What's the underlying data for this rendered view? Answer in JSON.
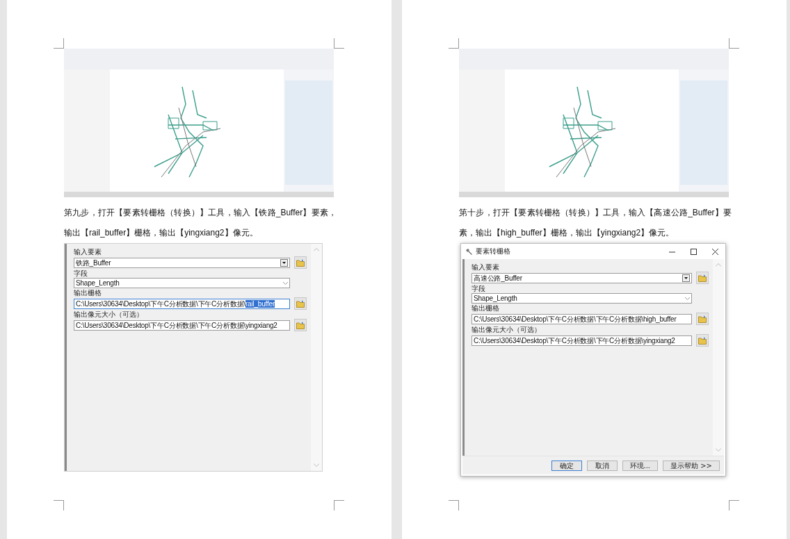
{
  "pages": [
    {
      "paragraph": "第九步，打开【要素转栅格（转换）】工具，输入【铁路_Buffer】要素，输出【rail_buffer】栅格，输出【yingxiang2】像元。",
      "dialog": {
        "fields": [
          {
            "kind": "combo",
            "label": "输入要素",
            "value": "铁路_Buffer"
          },
          {
            "kind": "dropdown",
            "label": "字段",
            "value": "Shape_Length"
          },
          {
            "kind": "path",
            "label": "输出栅格",
            "value": "C:\\Users\\30634\\Desktop\\下午C分析数据\\下午C分析数据\\",
            "selected_part": "rail_buffer",
            "focused": true
          },
          {
            "kind": "path",
            "label": "输出像元大小（可选）",
            "value": "C:\\Users\\30634\\Desktop\\下午C分析数据\\下午C分析数据\\yingxiang2",
            "focused": false
          }
        ]
      }
    },
    {
      "paragraph": "第十步，打开【要素转栅格（转换）】工具，输入【高速公路_Buffer】要素，输出【high_buffer】栅格，输出【yingxiang2】像元。",
      "dialog": {
        "title": "要素转栅格",
        "fields": [
          {
            "kind": "combo",
            "label": "输入要素",
            "value": "高速公路_Buffer"
          },
          {
            "kind": "dropdown",
            "label": "字段",
            "value": "Shape_Length"
          },
          {
            "kind": "path",
            "label": "输出栅格",
            "value": "C:\\Users\\30634\\Desktop\\下午C分析数据\\下午C分析数据\\high_buffer",
            "focused": false
          },
          {
            "kind": "path",
            "label": "输出像元大小（可选）",
            "value": "C:\\Users\\30634\\Desktop\\下午C分析数据\\下午C分析数据\\yingxiang2",
            "focused": false
          }
        ],
        "buttons": [
          {
            "label": "确定",
            "default": true
          },
          {
            "label": "取消",
            "default": false
          },
          {
            "label": "环境...",
            "default": false
          },
          {
            "label": "显示帮助 >>",
            "default": false
          }
        ]
      }
    }
  ]
}
